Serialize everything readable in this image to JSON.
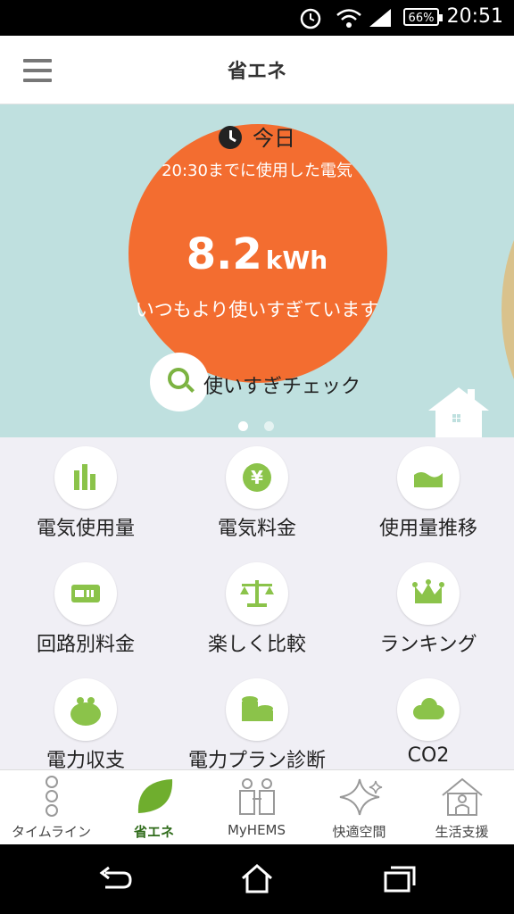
{
  "status_bar": {
    "time": "20:51",
    "battery": "66%"
  },
  "app_bar": {
    "title": "省エネ"
  },
  "hero": {
    "today_label": "今日",
    "subtitle": "20:30までに使用した電気",
    "usage_value": "8.2",
    "usage_unit": "kWh",
    "message": "いつもより使いすぎています",
    "check_button_label": "使いすぎチェック",
    "page_indicator": {
      "count": 2,
      "active": 0
    },
    "colors": {
      "background": "#bfe0df",
      "circle": "#f36d30"
    }
  },
  "grid": {
    "items": [
      {
        "label": "電気使用量",
        "icon": "bar-chart-icon"
      },
      {
        "label": "電気料金",
        "icon": "yen-icon"
      },
      {
        "label": "使用量推移",
        "icon": "area-chart-icon"
      },
      {
        "label": "回路別料金",
        "icon": "meter-icon"
      },
      {
        "label": "楽しく比較",
        "icon": "scale-icon"
      },
      {
        "label": "ランキング",
        "icon": "crown-icon"
      },
      {
        "label": "電力収支",
        "icon": "purse-icon"
      },
      {
        "label": "電力プラン診断",
        "icon": "coins-icon"
      },
      {
        "label": "CO2",
        "icon": "cloud-icon"
      }
    ],
    "accent_color": "#8bc34a"
  },
  "bottom_nav": {
    "items": [
      {
        "label": "タイムライン",
        "icon": "timeline-icon"
      },
      {
        "label": "省エネ",
        "icon": "leaf-icon",
        "active": true
      },
      {
        "label": "MyHEMS",
        "icon": "people-icon"
      },
      {
        "label": "快適空間",
        "icon": "sparkle-icon"
      },
      {
        "label": "生活支援",
        "icon": "house-person-icon"
      }
    ]
  }
}
